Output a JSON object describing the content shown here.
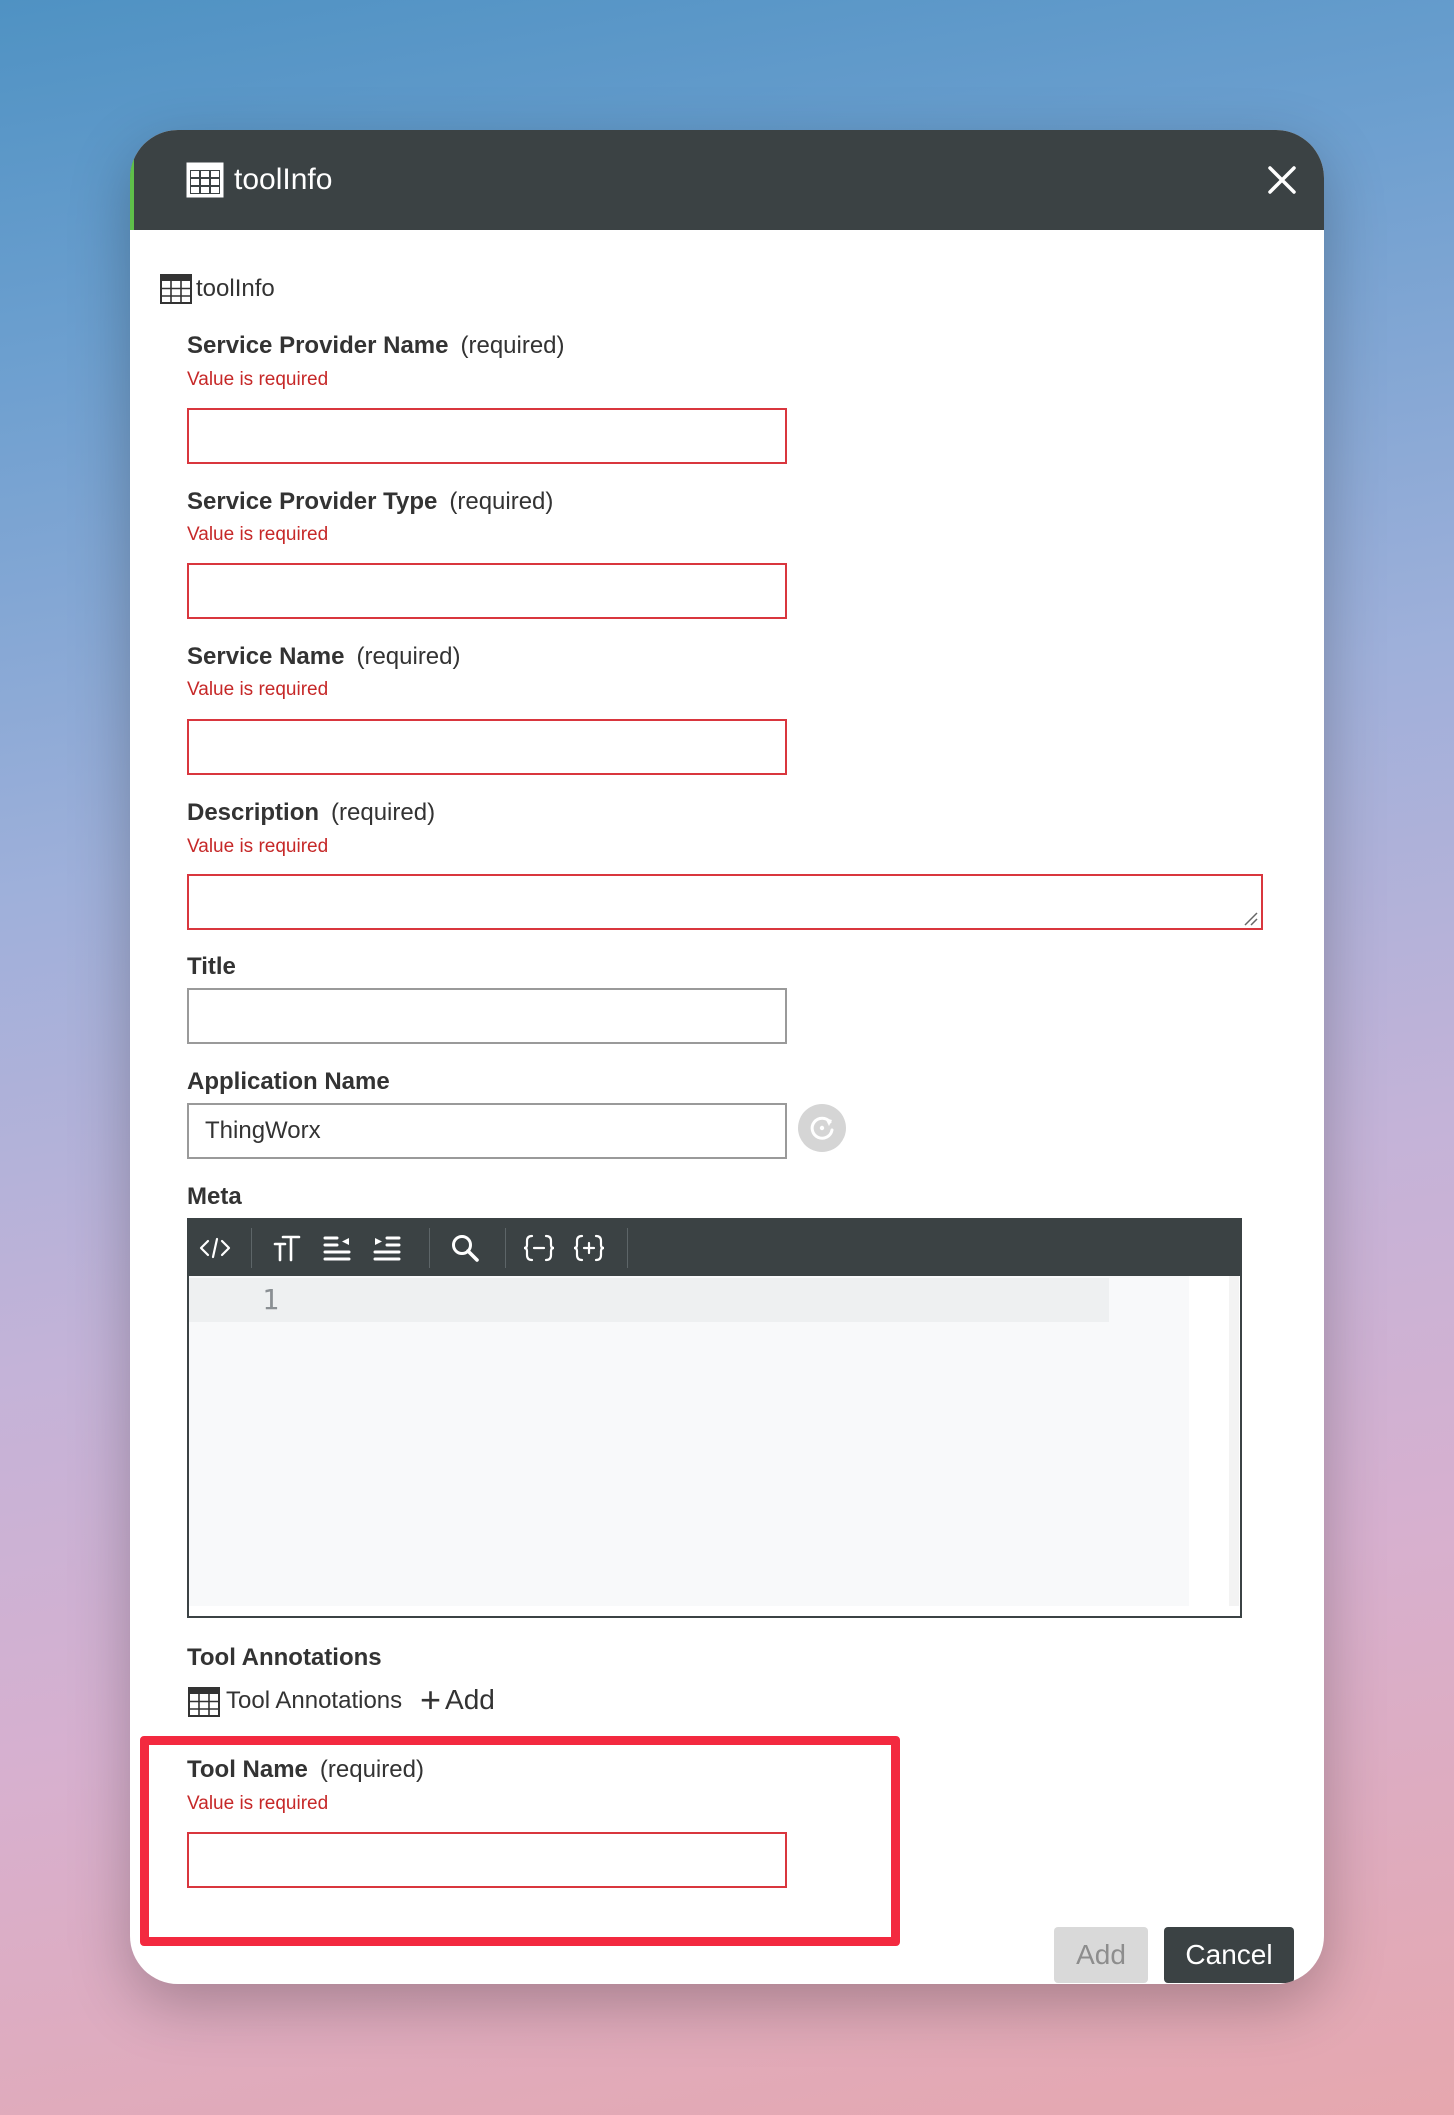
{
  "dialog": {
    "title": "toolInfo",
    "root_label": "toolInfo",
    "fields": [
      {
        "label": "Service Provider Name",
        "qualifier": "(required)",
        "error": "Value is required",
        "value": ""
      },
      {
        "label": "Service Provider Type",
        "qualifier": "(required)",
        "error": "Value is required",
        "value": ""
      },
      {
        "label": "Service Name",
        "qualifier": "(required)",
        "error": "Value is required",
        "value": ""
      },
      {
        "label": "Description",
        "qualifier": "(required)",
        "error": "Value is required",
        "value": ""
      },
      {
        "label": "Title",
        "value": ""
      },
      {
        "label": "Application Name",
        "value": "ThingWorx"
      }
    ],
    "meta": {
      "label": "Meta",
      "line_number": "1",
      "toolbar_icons": [
        "code-icon",
        "text-size-icon",
        "outdent-icon",
        "indent-icon",
        "search-icon",
        "collapse-braces-icon",
        "expand-braces-icon"
      ]
    },
    "tool_annotations": {
      "section_label": "Tool Annotations",
      "table_label": "Tool Annotations",
      "add_label": "Add"
    },
    "tool_name": {
      "label": "Tool Name",
      "qualifier": "(required)",
      "error": "Value is required",
      "value": ""
    },
    "buttons": {
      "add": "Add",
      "cancel": "Cancel"
    },
    "colors": {
      "header_bg": "#3b4244",
      "error": "#c62828",
      "invalid_border": "#d9363e",
      "highlight": "#f3293f",
      "accent_green": "#5fbf4a"
    }
  }
}
